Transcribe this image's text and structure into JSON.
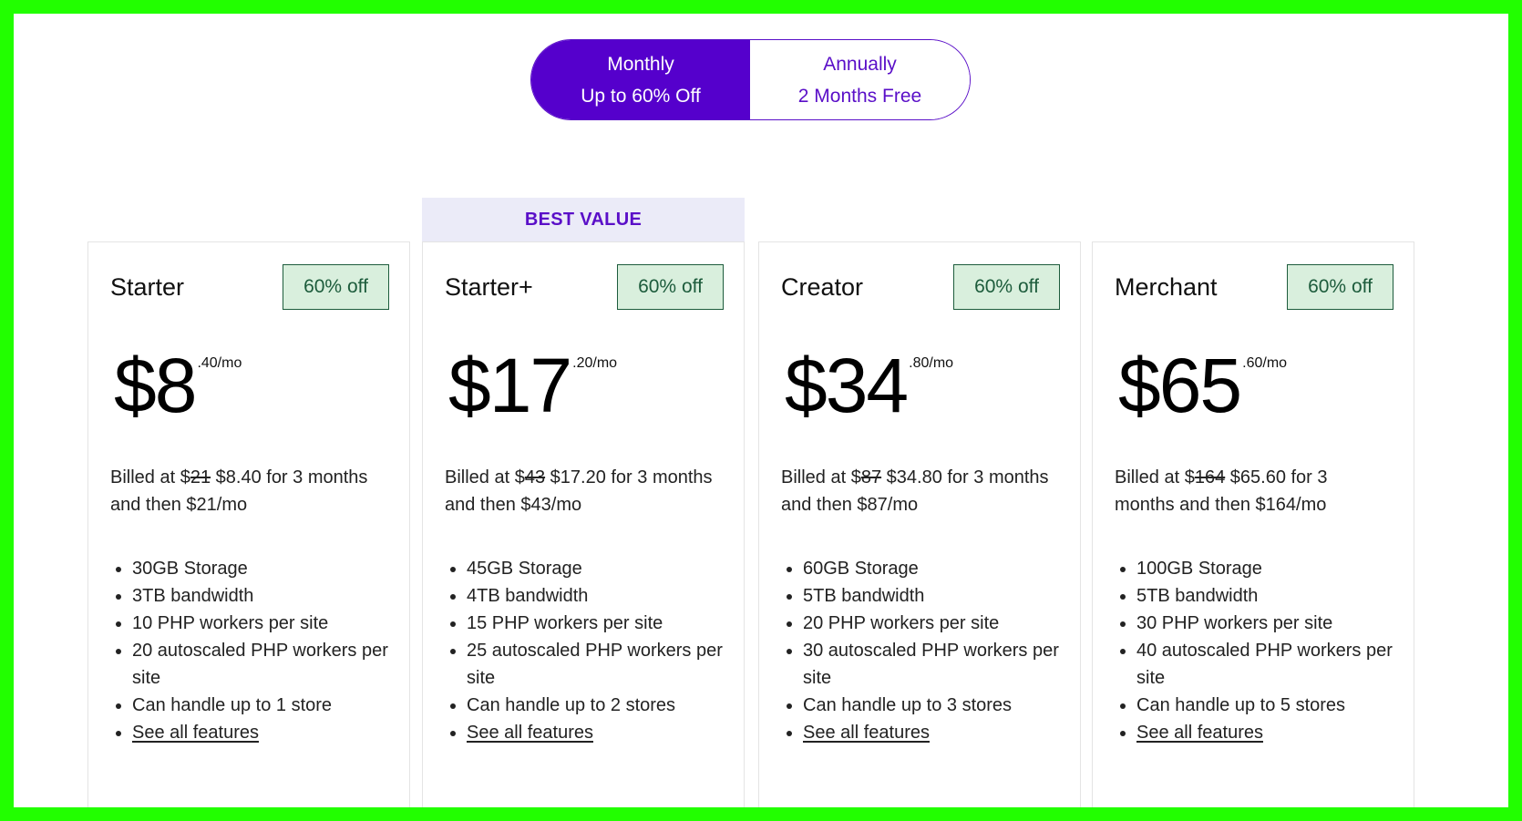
{
  "billing_toggle": {
    "monthly": {
      "title": "Monthly",
      "subtitle": "Up to 60% Off",
      "selected": true
    },
    "annually": {
      "title": "Annually",
      "subtitle": "2 Months Free",
      "selected": false
    }
  },
  "colors": {
    "accent": "#5500cc",
    "badge_bg": "#d9efdd",
    "badge_text": "#1d5c3c",
    "banner_bg": "#ebebf8"
  },
  "best_value_label": "BEST VALUE",
  "plans": [
    {
      "name": "Starter",
      "badge": "60% off",
      "price_whole": "$8",
      "price_fraction": ".40/mo",
      "billed_prefix": "Billed at $",
      "billed_original": "21",
      "billed_rest": " $8.40 for 3 months and then $21/mo",
      "features": [
        "30GB Storage",
        "3TB bandwidth",
        "10 PHP workers per site",
        "20 autoscaled PHP workers per site",
        "Can handle up to 1 store"
      ],
      "link": "See all features"
    },
    {
      "name": "Starter+",
      "badge": "60% off",
      "price_whole": "$17",
      "price_fraction": ".20/mo",
      "billed_prefix": "Billed at $",
      "billed_original": "43",
      "billed_rest": " $17.20 for 3 months and then $43/mo",
      "features": [
        "45GB Storage",
        "4TB bandwidth",
        "15 PHP workers per site",
        "25 autoscaled PHP workers per site",
        "Can handle up to 2 stores"
      ],
      "link": "See all features"
    },
    {
      "name": "Creator",
      "badge": "60% off",
      "price_whole": "$34",
      "price_fraction": ".80/mo",
      "billed_prefix": "Billed at $",
      "billed_original": "87",
      "billed_rest": " $34.80 for 3 months and then $87/mo",
      "features": [
        "60GB Storage",
        "5TB bandwidth",
        "20 PHP workers per site",
        "30 autoscaled PHP workers per site",
        "Can handle up to 3 stores"
      ],
      "link": "See all features"
    },
    {
      "name": "Merchant",
      "badge": "60% off",
      "price_whole": "$65",
      "price_fraction": ".60/mo",
      "billed_prefix": "Billed at $",
      "billed_original": "164",
      "billed_rest": " $65.60 for 3 months and then $164/mo",
      "features": [
        "100GB Storage",
        "5TB bandwidth",
        "30 PHP workers per site",
        "40 autoscaled PHP workers per site",
        "Can handle up to 5 stores"
      ],
      "link": "See all features"
    }
  ]
}
